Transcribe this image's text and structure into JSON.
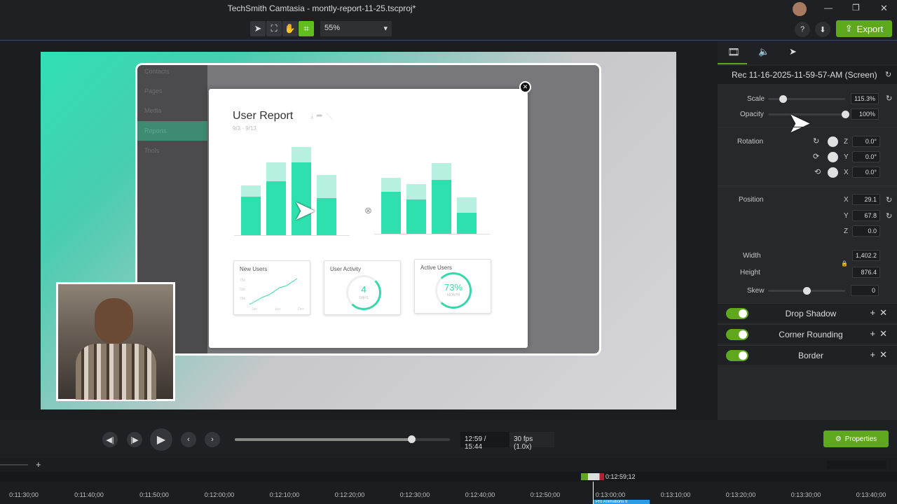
{
  "window": {
    "title": "TechSmith Camtasia - montly-report-11-25.tscproj*"
  },
  "toolbar": {
    "zoom": "55%",
    "export_label": "Export",
    "tools": [
      "select-tool",
      "transform-tool",
      "pan-tool",
      "crop-tool"
    ]
  },
  "report": {
    "title": "User Report",
    "date_range": "9/3 - 9/13",
    "nav": [
      "Contacts",
      "Pages",
      "Media",
      "Reports",
      "Tools"
    ],
    "chart_left": {
      "base": [
        50,
        70,
        95,
        48
      ],
      "top": [
        15,
        25,
        20,
        30
      ]
    },
    "chart_right": {
      "base": [
        55,
        45,
        70,
        27
      ],
      "top": [
        18,
        20,
        22,
        20
      ]
    },
    "cards": {
      "new_users": "New Users",
      "new_users_y": [
        "75k",
        "50k",
        "25k"
      ],
      "new_users_x": [
        "Jan",
        "Jun",
        "Dec"
      ],
      "user_activity": "User Activity",
      "activity_value": "4",
      "activity_unit": "DAYS",
      "active_users": "Active Users",
      "active_value": "73%",
      "active_unit": "MONTH"
    }
  },
  "properties": {
    "clip_name": "Rec 11-16-2025-11-59-57-AM (Screen)",
    "scale_label": "Scale",
    "scale": "115.3%",
    "scale_fraction": 0.1,
    "opacity_label": "Opacity",
    "opacity": "100%",
    "opacity_fraction": 1.0,
    "rotation_label": "Rotation",
    "rot_z": "0.0°",
    "rot_y": "0.0°",
    "rot_x": "0.0°",
    "position_label": "Position",
    "pos_x": "29.1",
    "pos_y": "67.8",
    "pos_z": "0.0",
    "width_label": "Width",
    "width": "1,402.2",
    "height_label": "Height",
    "height": "876.4",
    "skew_label": "Skew",
    "skew": "0",
    "effects": [
      {
        "name": "Drop Shadow",
        "enabled": true
      },
      {
        "name": "Corner Rounding",
        "enabled": true
      },
      {
        "name": "Border",
        "enabled": true
      }
    ],
    "axes": {
      "x": "X",
      "y": "Y",
      "z": "Z"
    }
  },
  "playback": {
    "time": "12:59 / 15:44",
    "fps": "30 fps (1.0x)",
    "progress": 0.82,
    "properties_label": "Properties"
  },
  "timeline": {
    "playhead": "0:12:59;12",
    "clip_label": "Pro Animations II",
    "ticks": [
      "0:11:30;00",
      "0:11:40;00",
      "0:11:50;00",
      "0:12:00;00",
      "0:12:10;00",
      "0:12:20;00",
      "0:12:30;00",
      "0:12:40;00",
      "0:12:50;00",
      "0:13:00;00",
      "0:13:10;00",
      "0:13:20;00",
      "0:13:30;00",
      "0:13:40;00"
    ]
  }
}
